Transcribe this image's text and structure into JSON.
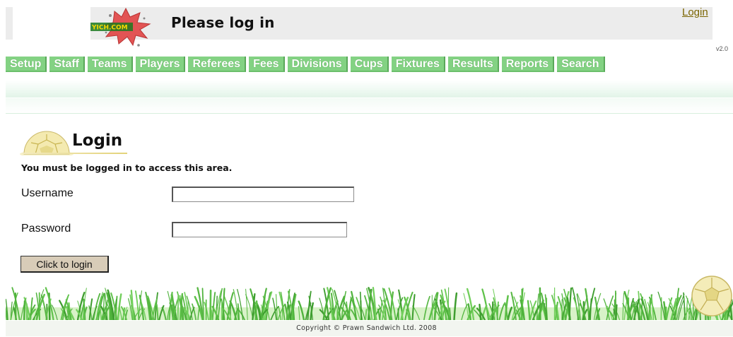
{
  "header": {
    "title": "Please log in",
    "login_link": "Login",
    "version": "v2.0",
    "logo_text": "YICH.COM"
  },
  "nav": {
    "tabs": [
      {
        "label": "Setup"
      },
      {
        "label": "Staff"
      },
      {
        "label": "Teams"
      },
      {
        "label": "Players"
      },
      {
        "label": "Referees"
      },
      {
        "label": "Fees"
      },
      {
        "label": "Divisions"
      },
      {
        "label": "Cups"
      },
      {
        "label": "Fixtures"
      },
      {
        "label": "Results"
      },
      {
        "label": "Reports"
      },
      {
        "label": "Search"
      }
    ]
  },
  "login": {
    "title": "Login",
    "notice": "You must be logged in to access this area.",
    "username_label": "Username",
    "username_value": "",
    "password_label": "Password",
    "password_value": "",
    "button_label": "Click to login"
  },
  "footer": {
    "copyright": "Copyright © Prawn Sandwich Ltd. 2008"
  },
  "colors": {
    "tab_bg": "#83d283",
    "header_bg": "#ececec",
    "login_link": "#7a6400",
    "grass": "#5fbf4a"
  },
  "icons": {
    "logo": "splat-logo-icon",
    "login": "football-icon",
    "footer": "football-icon"
  }
}
